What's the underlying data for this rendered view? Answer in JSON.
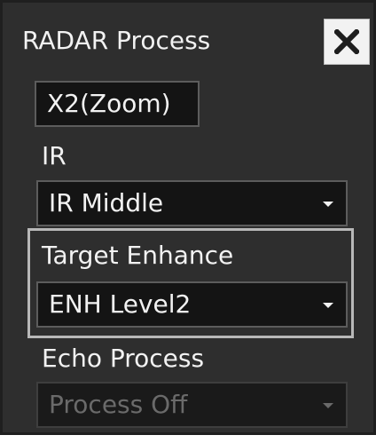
{
  "window": {
    "title": "RADAR Process",
    "close_icon": "close-icon"
  },
  "zoom_button": {
    "label": "X2(Zoom)"
  },
  "ir": {
    "label": "IR",
    "selected": "IR Middle"
  },
  "target_enhance": {
    "label": "Target Enhance",
    "selected": "ENH Level2"
  },
  "echo_process": {
    "label": "Echo Process",
    "selected": "Process Off",
    "disabled": true
  },
  "colors": {
    "panel_background": "#2e2e2e",
    "control_background": "#141414",
    "text": "#f2f2f2",
    "disabled_text": "#6a6a6a",
    "group_frame": "#b8b8b8"
  }
}
